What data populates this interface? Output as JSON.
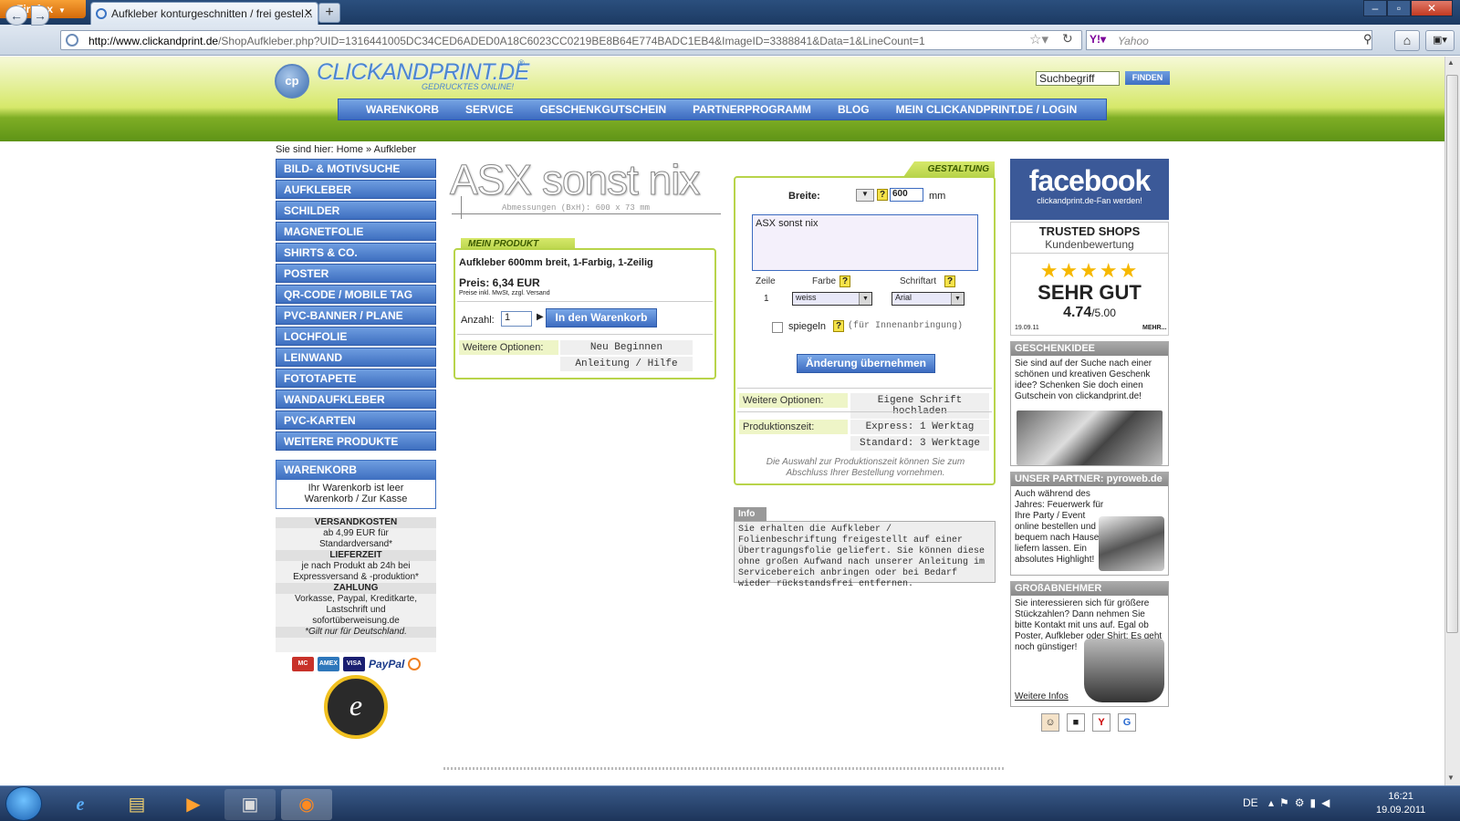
{
  "browser": {
    "app_button": "Firefox",
    "tab_title": "Aufkleber konturgeschnitten / frei gestel...",
    "url_domain": "http://www.clickandprint.de",
    "url_path": "/ShopAufkleber.php?UID=1316441005DC34CED6ADED0A18C6023CC0219BE8B64E774BADC1EB4&ImageID=3388841&Data=1&LineCount=1",
    "search_engine": "Yahoo",
    "search_placeholder": "Yahoo"
  },
  "site": {
    "logo_name": "CLICKANDPRINT.DE",
    "logo_reg": "®",
    "logo_tagline": "GEDRUCKTES ONLINE!",
    "logo_icon_text": "cp",
    "search_value": "Suchbegriff",
    "search_button": "FINDEN",
    "topnav": [
      "WARENKORB",
      "SERVICE",
      "GESCHENKGUTSCHEIN",
      "PARTNERPROGRAMM",
      "BLOG",
      "MEIN CLICKANDPRINT.DE  /  LOGIN"
    ],
    "breadcrumb": "Sie sind hier: Home » Aufkleber"
  },
  "left_menu": [
    "BILD- & MOTIVSUCHE",
    "AUFKLEBER",
    "SCHILDER",
    "MAGNETFOLIE",
    "SHIRTS & CO.",
    "POSTER",
    "QR-CODE / MOBILE TAG",
    "PVC-BANNER / PLANE",
    "LOCHFOLIE",
    "LEINWAND",
    "FOTOTAPETE",
    "WANDAUFKLEBER",
    "PVC-KARTEN",
    "WEITERE PRODUKTE"
  ],
  "cart": {
    "title": "WARENKORB",
    "empty": "Ihr Warenkorb ist leer",
    "link": "Warenkorb / Zur Kasse"
  },
  "shipping_info": {
    "versand_title": "VERSANDKOSTEN",
    "versand_text": "ab 4,99 EUR für Standardversand*",
    "liefer_title": "LIEFERZEIT",
    "liefer_text": "je nach Produkt ab 24h bei Expressversand & -produktion*",
    "zahlung_title": "ZAHLUNG",
    "zahlung_text": "Vorkasse, Paypal, Kreditkarte, Lastschrift und sofortüberweisung.de",
    "footnote": "*Gilt nur für Deutschland."
  },
  "payment": [
    "MC",
    "AMEX",
    "VISA",
    "PayPal"
  ],
  "preview": {
    "text": "ASX sonst nix",
    "dimensions": "Abmessungen (BxH): 600 x 73 mm"
  },
  "product": {
    "tab": "MEIN PRODUKT",
    "title": "Aufkleber 600mm breit, 1-Farbig, 1-Zeilig",
    "price": "Preis: 6,34 EUR",
    "price_note": "Preise inkl. MwSt, zzgl. Versand",
    "qty_label": "Anzahl:",
    "qty_value": "1",
    "add_to_cart": "In den Warenkorb",
    "options_label": "Weitere Optionen:",
    "option_restart": "Neu Beginnen",
    "option_help": "Anleitung / Hilfe"
  },
  "design": {
    "tab": "GESTALTUNG",
    "width_label": "Breite:",
    "width_value": "600",
    "width_unit": "mm",
    "text_value": "ASX sonst nix",
    "col_line": "Zeile",
    "col_color": "Farbe",
    "col_font": "Schriftart",
    "line_no": "1",
    "color_value": "weiss",
    "font_value": "Arial",
    "mirror_label": "spiegeln",
    "mirror_note": "(für Innenanbringung)",
    "apply_button": "Änderung übernehmen",
    "options_label": "Weitere Optionen:",
    "upload_font": "Eigene Schrift hochladen",
    "production_label": "Produktionszeit:",
    "express": "Express: 1 Werktag",
    "standard": "Standard: 3 Werktage",
    "footnote": "Die Auswahl zur Produktionszeit können Sie zum Abschluss Ihrer Bestellung vornehmen."
  },
  "info": {
    "tab": "Info",
    "text": "Sie erhalten die Aufkleber / Folienbeschriftung freigestellt auf einer Übertragungsfolie geliefert. Sie können diese ohne großen Aufwand nach unserer Anleitung im Servicebereich anbringen oder bei Bedarf wieder rückstandsfrei entfernen."
  },
  "right": {
    "fb_word": "facebook",
    "fb_sub": "clickandprint.de-Fan werden!",
    "ts_title": "TRUSTED SHOPS",
    "ts_sub": "Kundenbewertung",
    "ts_stars": "★★★★★",
    "ts_rating": "SEHR GUT",
    "ts_score": "4.74",
    "ts_max": "/5.00",
    "ts_date": "19.09.11",
    "ts_more": "MEHR...",
    "gift_title": "GESCHENKIDEE",
    "gift_text": "Sie sind auf der Suche nach einer schönen und kreativen Geschenk idee? Schenken Sie doch einen Gutschein von clickandprint.de!",
    "partner_title": "UNSER PARTNER: pyroweb.de",
    "partner_text": "Auch während des Jahres: Feuerwerk für Ihre Party / Event online bestellen und bequem nach Hause liefern lassen. Ein absolutes Highlight!",
    "bulk_title": "GROßABNEHMER",
    "bulk_text": "Sie interessieren sich für größere Stückzahlen? Dann nehmen Sie bitte Kontakt mit uns auf. Egal ob Poster, Aufkleber oder Shirt: Es geht noch günstiger!",
    "bulk_link": "Weitere Infos"
  },
  "trusted_seal": {
    "letter": "e"
  },
  "taskbar": {
    "lang": "DE",
    "time": "16:21",
    "date": "19.09.2011"
  },
  "colors": {
    "accent_blue": "#3e6fc0",
    "accent_green": "#b8d44a",
    "facebook": "#3b5998"
  }
}
